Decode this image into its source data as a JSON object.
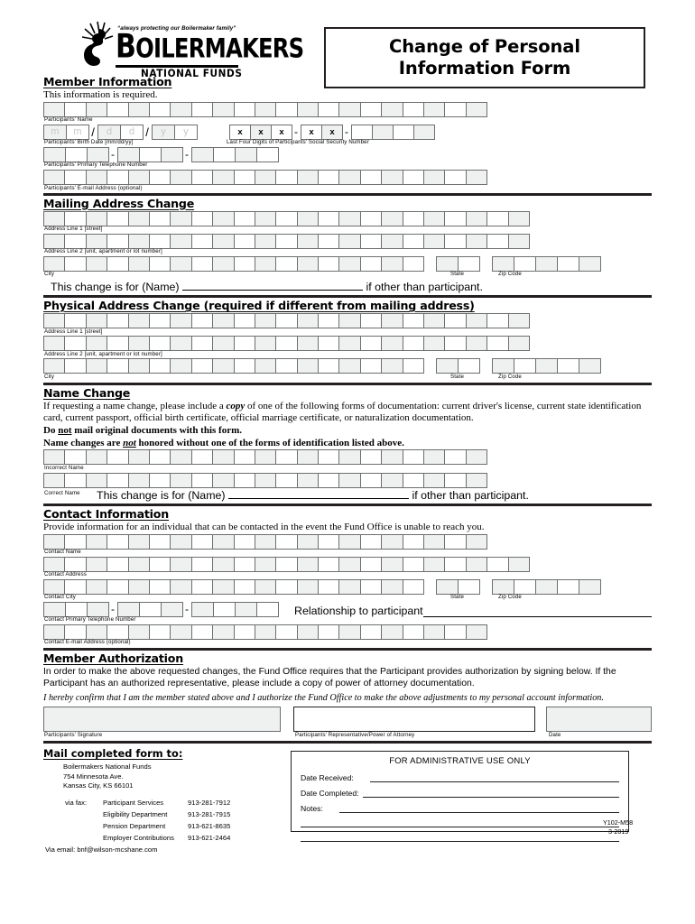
{
  "header": {
    "logo": {
      "tagline": "“always protecting our Boilermaker family”",
      "wordmark_first": "B",
      "wordmark_rest": "OILERMAKERS",
      "subtitle": "NATIONAL FUNDS",
      "torch_icon": "torch-icon"
    },
    "title_line1": "Change of Personal",
    "title_line2": "Information Form"
  },
  "member_information": {
    "title": "Member Information",
    "subtitle": "This information is required.",
    "name_label": "Participants' Name",
    "birth_label": "Participants' Birth Date [mm/dd/yy]",
    "birth_placeholders": [
      "m",
      "m",
      "d",
      "d",
      "y",
      "y"
    ],
    "ssn_label": "Last Four Digits of Participants' Social Security Number",
    "ssn_masked": [
      "x",
      "x",
      "x",
      "x",
      "x"
    ],
    "phone_label": "Participants' Primary Telephone Number",
    "email_label": "Participants' E-mail Address (optional)",
    "slash": "/",
    "dash": "-"
  },
  "mailing_address": {
    "title": "Mailing Address Change",
    "line1_label": "Address Line 1 [street]",
    "line2_label": "Address Line 2 [unit, apartment or lot number]",
    "city_label": "City",
    "state_label": "State",
    "zip_label": "Zip Code",
    "change_for_prefix": "This change is for (Name)",
    "change_for_suffix": "if other than participant."
  },
  "physical_address": {
    "title": "Physical Address Change (required if different from mailing address)",
    "line1_label": "Address Line 1 [street]",
    "line2_label": "Address Line 2 [unit, apartment or lot number]",
    "city_label": "City",
    "state_label": "State",
    "zip_label": "Zip Code"
  },
  "name_change": {
    "title": "Name Change",
    "para1_a": "If requesting a name change, please include a ",
    "para1_copy": "copy",
    "para1_b": " of one of the following forms of documentation: current driver's license, current state identification card, current passport, official birth certificate, official marriage certificate, or naturalization documentation.",
    "para2_a": "Do ",
    "para2_not": "not",
    "para2_b": " mail original documents with this form.",
    "para3_a": "Name changes are ",
    "para3_not": "not",
    "para3_b": " honored without one of the forms of identification listed above.",
    "incorrect_label": "Incorrect Name",
    "correct_label": "Correct Name",
    "change_for_prefix": "This change is for (Name)",
    "change_for_suffix": "if other than participant."
  },
  "contact_information": {
    "title": "Contact Information",
    "subtitle": "Provide information for an individual that can be contacted in the event the Fund Office is unable to reach you.",
    "name_label": "Contact Name",
    "address_label": "Contact Address",
    "city_label": "Contact City",
    "state_label": "State",
    "zip_label": "Zip Code",
    "phone_label": "Contact Primary Telephone Number",
    "relationship_label": "Relationship to participant",
    "email_label": "Contact E-mail Address (optional)",
    "dash": "-"
  },
  "member_authorization": {
    "title": "Member Authorization",
    "para1": "In order to make the above requested changes, the Fund Office requires that the Participant provides authorization by signing below. If the Participant has an authorized representative, please include a copy of power of attorney documentation.",
    "para2": "I hereby confirm that I am the member stated above and I authorize the Fund Office to make the above adjustments to my personal account information.",
    "signature_label": "Participants' Signature",
    "representative_label": "Participants' Representative/Power of Attorney",
    "date_label": "Date"
  },
  "footer": {
    "mail_title": "Mail completed form to:",
    "address_lines": [
      "Boilermakers National Funds",
      "754 Minnesota Ave.",
      "Kansas City, KS 66101"
    ],
    "via_fax_label": "via fax:",
    "fax_rows": [
      {
        "dept": "Participant Services",
        "number": "913-281-7912"
      },
      {
        "dept": "Eligibility Department",
        "number": "913-281-7915"
      },
      {
        "dept": "Pension Department",
        "number": "913-621-8635"
      },
      {
        "dept": "Employer Contributions",
        "number": "913-621-2464"
      }
    ],
    "via_email": "Via email: bnf@wilson-mcshane.com",
    "admin": {
      "heading": "FOR ADMINISTRATIVE USE ONLY",
      "date_received_label": "Date Received:",
      "date_completed_label": "Date Completed:",
      "notes_label": "Notes:"
    },
    "form_number": "Y102-M58",
    "form_date": "3-2019"
  },
  "colors": {
    "rule": "#231f20",
    "cell_border": "#6d6e71",
    "cell_shade": "#eff0f0",
    "placeholder": "#c7c8ca"
  }
}
